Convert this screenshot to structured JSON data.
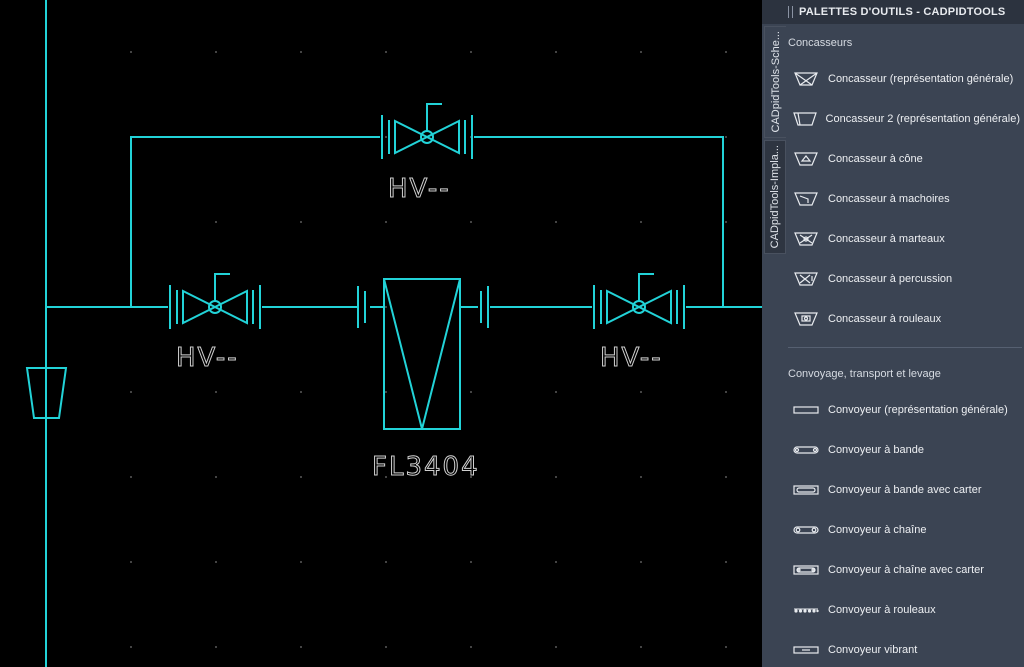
{
  "drawing": {
    "labels": {
      "valve_top": "HV--",
      "valve_left": "HV--",
      "valve_right": "HV--",
      "filter": "FL3404"
    },
    "colors": {
      "pipe": "#22d3d8",
      "text": "#d0d0d0",
      "background": "#000000"
    }
  },
  "palette": {
    "title": "PALETTES D'OUTILS - CADPIDTOOLS",
    "tabs": [
      {
        "label": "CADpidTools-Sche..."
      },
      {
        "label": "CADpidTools-Impla..."
      }
    ],
    "sections": [
      {
        "title": "Concasseurs",
        "items": [
          {
            "label": "Concasseur (représentation générale)",
            "icon": "crusher-general-icon"
          },
          {
            "label": "Concasseur 2 (représentation générale)",
            "icon": "crusher-2-icon"
          },
          {
            "label": "Concasseur à cône",
            "icon": "cone-crusher-icon"
          },
          {
            "label": "Concasseur à machoires",
            "icon": "jaw-crusher-icon"
          },
          {
            "label": "Concasseur à marteaux",
            "icon": "hammer-crusher-icon"
          },
          {
            "label": "Concasseur à percussion",
            "icon": "impact-crusher-icon"
          },
          {
            "label": "Concasseur à rouleaux",
            "icon": "roller-crusher-icon"
          }
        ]
      },
      {
        "title": "Convoyage, transport et levage",
        "items": [
          {
            "label": "Convoyeur (représentation générale)",
            "icon": "conveyor-general-icon"
          },
          {
            "label": "Convoyeur à bande",
            "icon": "belt-conveyor-icon"
          },
          {
            "label": "Convoyeur à bande avec carter",
            "icon": "covered-belt-conveyor-icon"
          },
          {
            "label": "Convoyeur à chaîne",
            "icon": "chain-conveyor-icon"
          },
          {
            "label": "Convoyeur à chaîne avec carter",
            "icon": "covered-chain-conveyor-icon"
          },
          {
            "label": "Convoyeur à rouleaux",
            "icon": "roller-conveyor-icon"
          },
          {
            "label": "Convoyeur vibrant",
            "icon": "vibrating-conveyor-icon"
          }
        ]
      }
    ]
  }
}
